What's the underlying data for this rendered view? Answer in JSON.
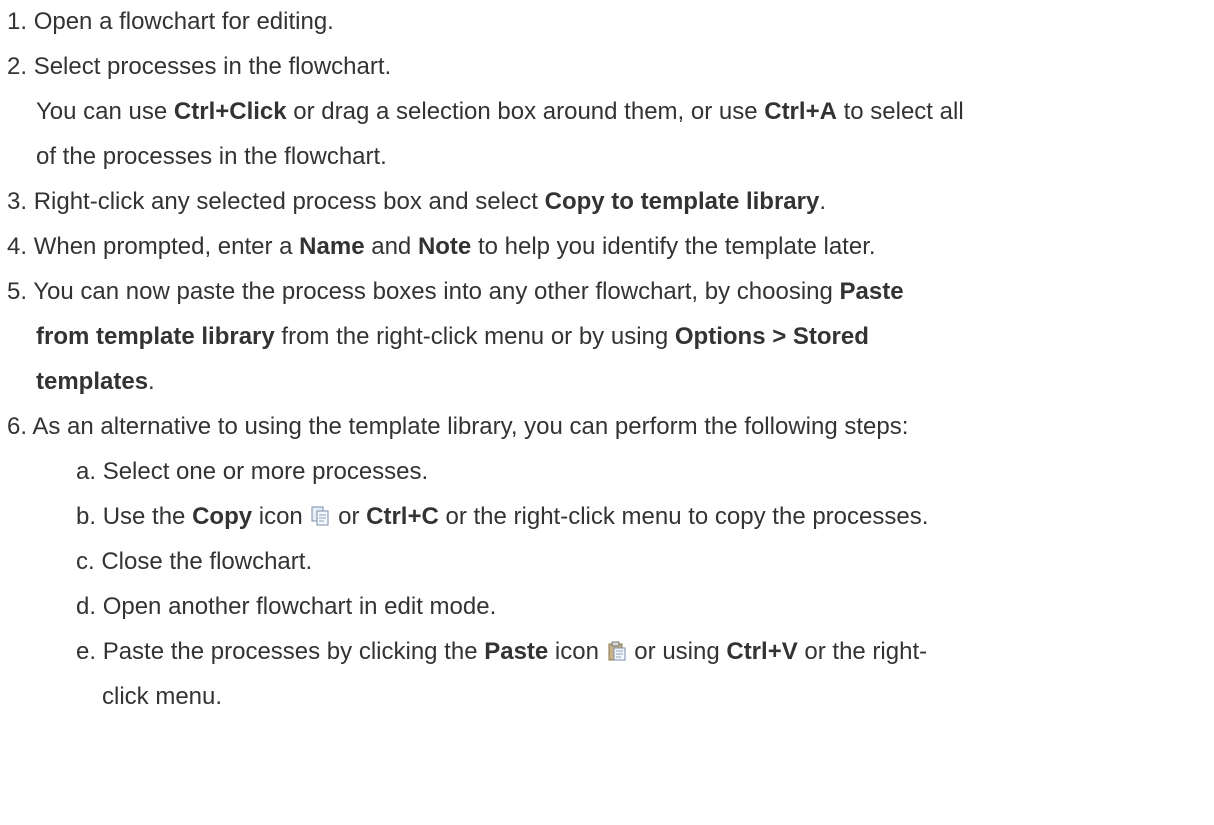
{
  "steps": [
    {
      "num": "1.",
      "text": "Open a flowchart for editing."
    },
    {
      "num": "2.",
      "text": "Select processes in the flowchart.",
      "note": {
        "t1": "You can use ",
        "b1": "Ctrl+Click",
        "t2": " or drag a selection box around them, or use ",
        "b2": "Ctrl+A",
        "t3": " to select all",
        "t4": "of the processes in the flowchart."
      }
    },
    {
      "num": "3.",
      "t1": "Right-click any selected process box and select ",
      "b1": "Copy to template library",
      "t2": "."
    },
    {
      "num": "4.",
      "t1": "When prompted, enter a ",
      "b1": "Name",
      "t2": " and ",
      "b2": "Note",
      "t3": " to help you identify the template later."
    },
    {
      "num": "5.",
      "t1": "You can now paste the process boxes into any other flowchart, by choosing ",
      "b1": "Paste",
      "b2": "from template library",
      "t2": " from the right-click menu or by using ",
      "b3": "Options > Stored",
      "b4": "templates",
      "t3": "."
    },
    {
      "num": "6.",
      "text": "As an alternative to using the template library, you can perform the following steps:",
      "substeps": [
        {
          "letter": "a.",
          "text": "Select one or more processes."
        },
        {
          "letter": "b.",
          "t1": "Use the ",
          "b1": "Copy",
          "t2": " icon ",
          "icon": "copy-icon",
          "t3": " or ",
          "b2": "Ctrl+C",
          "t4": " or the right-click menu to copy the processes."
        },
        {
          "letter": "c.",
          "text": "Close the flowchart."
        },
        {
          "letter": "d.",
          "text": "Open another flowchart in edit mode."
        },
        {
          "letter": "e.",
          "t1": "Paste the processes by clicking the ",
          "b1": "Paste",
          "t2": " icon ",
          "icon": "paste-icon",
          "t3": " or using ",
          "b2": "Ctrl+V",
          "t4": " or the right-",
          "t5": "click menu."
        }
      ]
    }
  ]
}
